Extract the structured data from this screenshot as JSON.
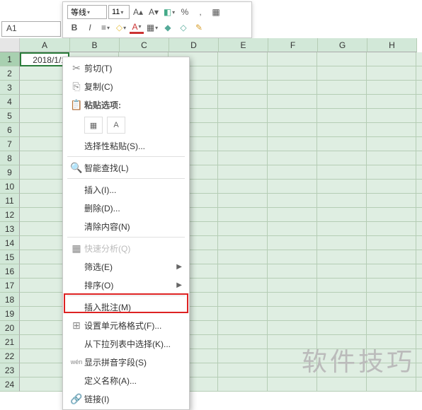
{
  "namebox": "A1",
  "toolbar": {
    "font": "等线",
    "size": "11",
    "btns_row1": [
      "A▴",
      "A▾",
      "◧",
      "%",
      ",",
      "▦"
    ],
    "btns_row2": [
      "B",
      "I",
      "≡",
      "◇",
      "A",
      "▦",
      "◆",
      "◇",
      "✎"
    ]
  },
  "columns": [
    "A",
    "B",
    "C",
    "D",
    "E",
    "F",
    "G",
    "H"
  ],
  "rows": [
    "1",
    "2",
    "3",
    "4",
    "5",
    "6",
    "7",
    "8",
    "9",
    "10",
    "11",
    "12",
    "13",
    "14",
    "15",
    "16",
    "17",
    "18",
    "19",
    "20",
    "21",
    "22",
    "23",
    "24"
  ],
  "cell_a1": "2018/1/1",
  "ctx": [
    {
      "icon": "✂",
      "label": "剪切(T)",
      "type": "item"
    },
    {
      "icon": "⎘",
      "label": "复制(C)",
      "type": "item"
    },
    {
      "icon": "📋",
      "label": "粘贴选项:",
      "type": "hdr"
    },
    {
      "type": "paste-opts",
      "opts": [
        "▦",
        "A"
      ]
    },
    {
      "icon": "",
      "label": "选择性粘贴(S)...",
      "type": "item"
    },
    {
      "type": "sep"
    },
    {
      "icon": "🔍",
      "label": "智能查找(L)",
      "type": "item"
    },
    {
      "type": "sep"
    },
    {
      "icon": "",
      "label": "插入(I)...",
      "type": "item"
    },
    {
      "icon": "",
      "label": "删除(D)...",
      "type": "item"
    },
    {
      "icon": "",
      "label": "清除内容(N)",
      "type": "item"
    },
    {
      "type": "sep"
    },
    {
      "icon": "▦",
      "label": "快速分析(Q)",
      "type": "item",
      "disabled": true
    },
    {
      "icon": "",
      "label": "筛选(E)",
      "type": "sub"
    },
    {
      "icon": "",
      "label": "排序(O)",
      "type": "sub"
    },
    {
      "type": "sep"
    },
    {
      "icon": "",
      "label": "插入批注(M)",
      "type": "item"
    },
    {
      "icon": "⊞",
      "label": "设置单元格格式(F)...",
      "type": "item",
      "hl": true
    },
    {
      "icon": "",
      "label": "从下拉列表中选择(K)...",
      "type": "item"
    },
    {
      "icon": "wén",
      "label": "显示拼音字段(S)",
      "type": "item"
    },
    {
      "icon": "",
      "label": "定义名称(A)...",
      "type": "item"
    },
    {
      "icon": "🔗",
      "label": "链接(I)",
      "type": "item"
    }
  ],
  "watermark": "软件技巧"
}
